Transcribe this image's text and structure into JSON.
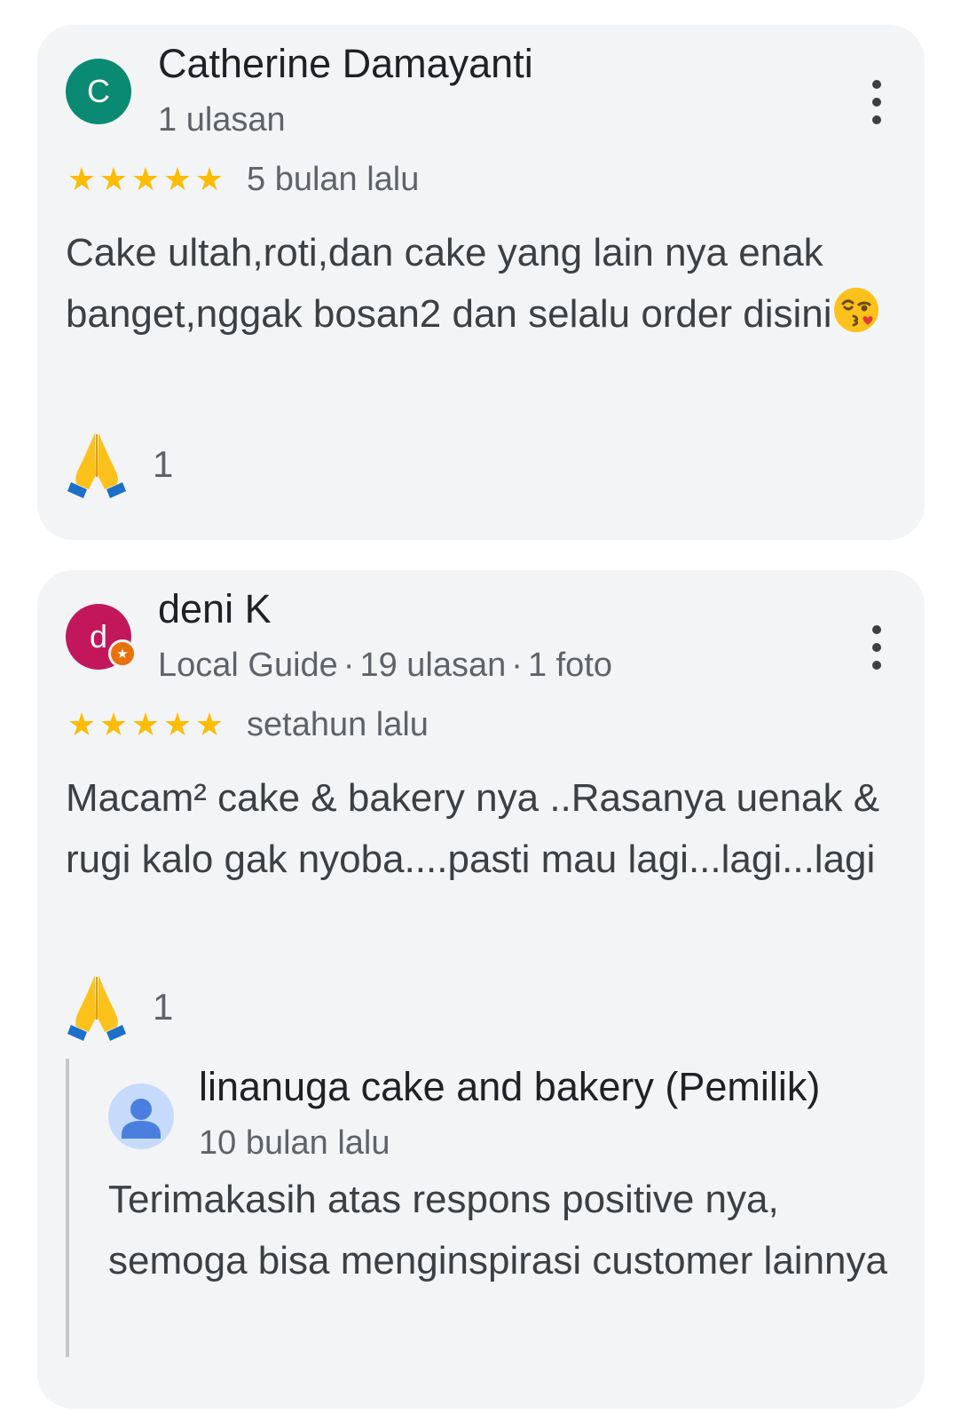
{
  "reviews": [
    {
      "avatar_letter": "C",
      "avatar_color": "#0b8a73",
      "name": "Catherine Damayanti",
      "meta": "1 ulasan",
      "rating": 5,
      "time": "5 bulan lalu",
      "text": "Cake ultah,roti,dan cake yang lain nya enak banget,nggak bosan2 dan selalu order disini",
      "text_emoji": "kissing-face-emoji",
      "reaction_icon": "folded-hands-emoji",
      "reaction_count": "1"
    },
    {
      "avatar_letter": "d",
      "avatar_color": "#c2185b",
      "name": "deni K",
      "meta_badge": "Local Guide",
      "meta_reviews": "19 ulasan",
      "meta_photos": "1 foto",
      "rating": 5,
      "time": "setahun lalu",
      "text": "Macam² cake & bakery nya ..Rasanya uenak & rugi kalo gak nyoba....pasti mau lagi...lagi...lagi",
      "reaction_icon": "folded-hands-emoji",
      "reaction_count": "1",
      "owner_reply": {
        "name": "linanuga cake and bakery (Pemilik)",
        "time": "10 bulan lalu",
        "text": "Terimakasih atas respons positive nya, semoga bisa menginspirasi customer lainnya"
      }
    }
  ],
  "star_color": "#fbbc04",
  "separator": "·"
}
